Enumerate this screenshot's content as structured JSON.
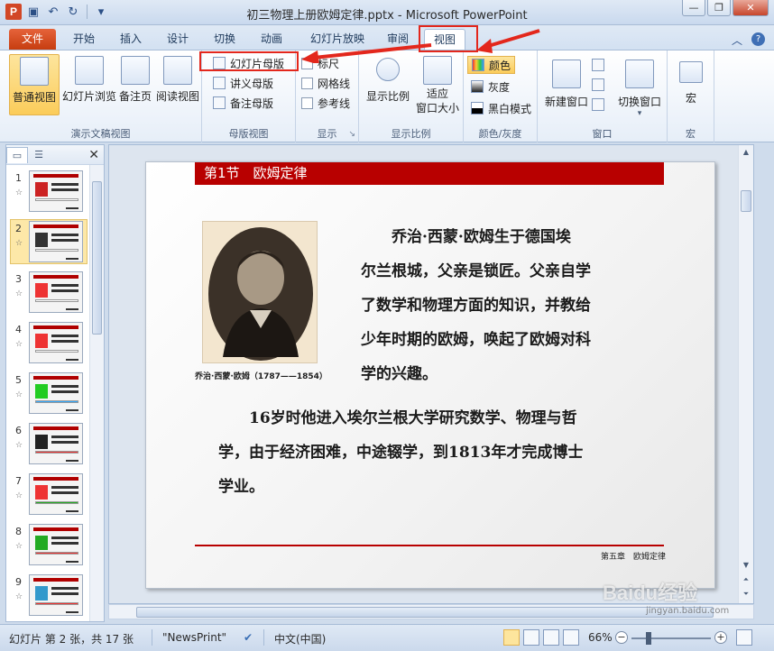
{
  "window": {
    "title": "初三物理上册欧姆定律.pptx - Microsoft PowerPoint",
    "app_icon": "P",
    "controls": [
      "—",
      "❐",
      "✕"
    ]
  },
  "tabs": [
    {
      "label": "文件"
    },
    {
      "label": "开始"
    },
    {
      "label": "插入"
    },
    {
      "label": "设计"
    },
    {
      "label": "切换"
    },
    {
      "label": "动画"
    },
    {
      "label": "幻灯片放映"
    },
    {
      "label": "审阅"
    },
    {
      "label": "视图"
    }
  ],
  "ribbon": {
    "presentation_views": {
      "label": "演示文稿视图",
      "normal": "普通视图",
      "sorter": "幻灯片浏览",
      "notes": "备注页",
      "reading": "阅读视图"
    },
    "master_views": {
      "label": "母版视图",
      "slide_master": "幻灯片母版",
      "handout_master": "讲义母版",
      "notes_master": "备注母版"
    },
    "show": {
      "label": "显示",
      "ruler": "标尺",
      "gridlines": "网格线",
      "guides": "参考线"
    },
    "zoom": {
      "label": "显示比例",
      "zoom": "显示比例",
      "fit_line1": "适应",
      "fit_line2": "窗口大小"
    },
    "color": {
      "label": "颜色/灰度",
      "color": "颜色",
      "grayscale": "灰度",
      "bw": "黑白模式"
    },
    "window": {
      "label": "窗口",
      "new_window": "新建窗口",
      "switch_window": "切换窗口"
    },
    "macros": {
      "label": "宏",
      "macro": "宏"
    }
  },
  "thumbnails": [
    {
      "num": "1"
    },
    {
      "num": "2"
    },
    {
      "num": "3"
    },
    {
      "num": "4"
    },
    {
      "num": "5"
    },
    {
      "num": "6"
    },
    {
      "num": "7"
    },
    {
      "num": "8"
    },
    {
      "num": "9"
    }
  ],
  "slide": {
    "header": "第1节　欧姆定律",
    "caption": "乔治·西蒙·欧姆（1787——1854）",
    "para1": [
      "　　乔治·西蒙·欧姆生于德国埃",
      "尔兰根城，父亲是锁匠。父亲自学",
      "了数学和物理方面的知识，并教给",
      "少年时期的欧姆，唤起了欧姆对科",
      "学的兴趣。"
    ],
    "para2": [
      "　　16岁时他进入埃尔兰根大学研究数学、物理与哲",
      "学，由于经济困难，中途辍学，到1813年才完成博士",
      "学业。"
    ],
    "footer": "第五章　欧姆定律",
    "header_color": "#b80000"
  },
  "statusbar": {
    "slide_info": "幻灯片 第 2 张，共 17 张",
    "theme": "\"NewsPrint\"",
    "language": "中文(中国)",
    "zoom": "66%"
  },
  "watermark": {
    "brand": "Baidu经验",
    "url": "jingyan.baidu.com"
  }
}
